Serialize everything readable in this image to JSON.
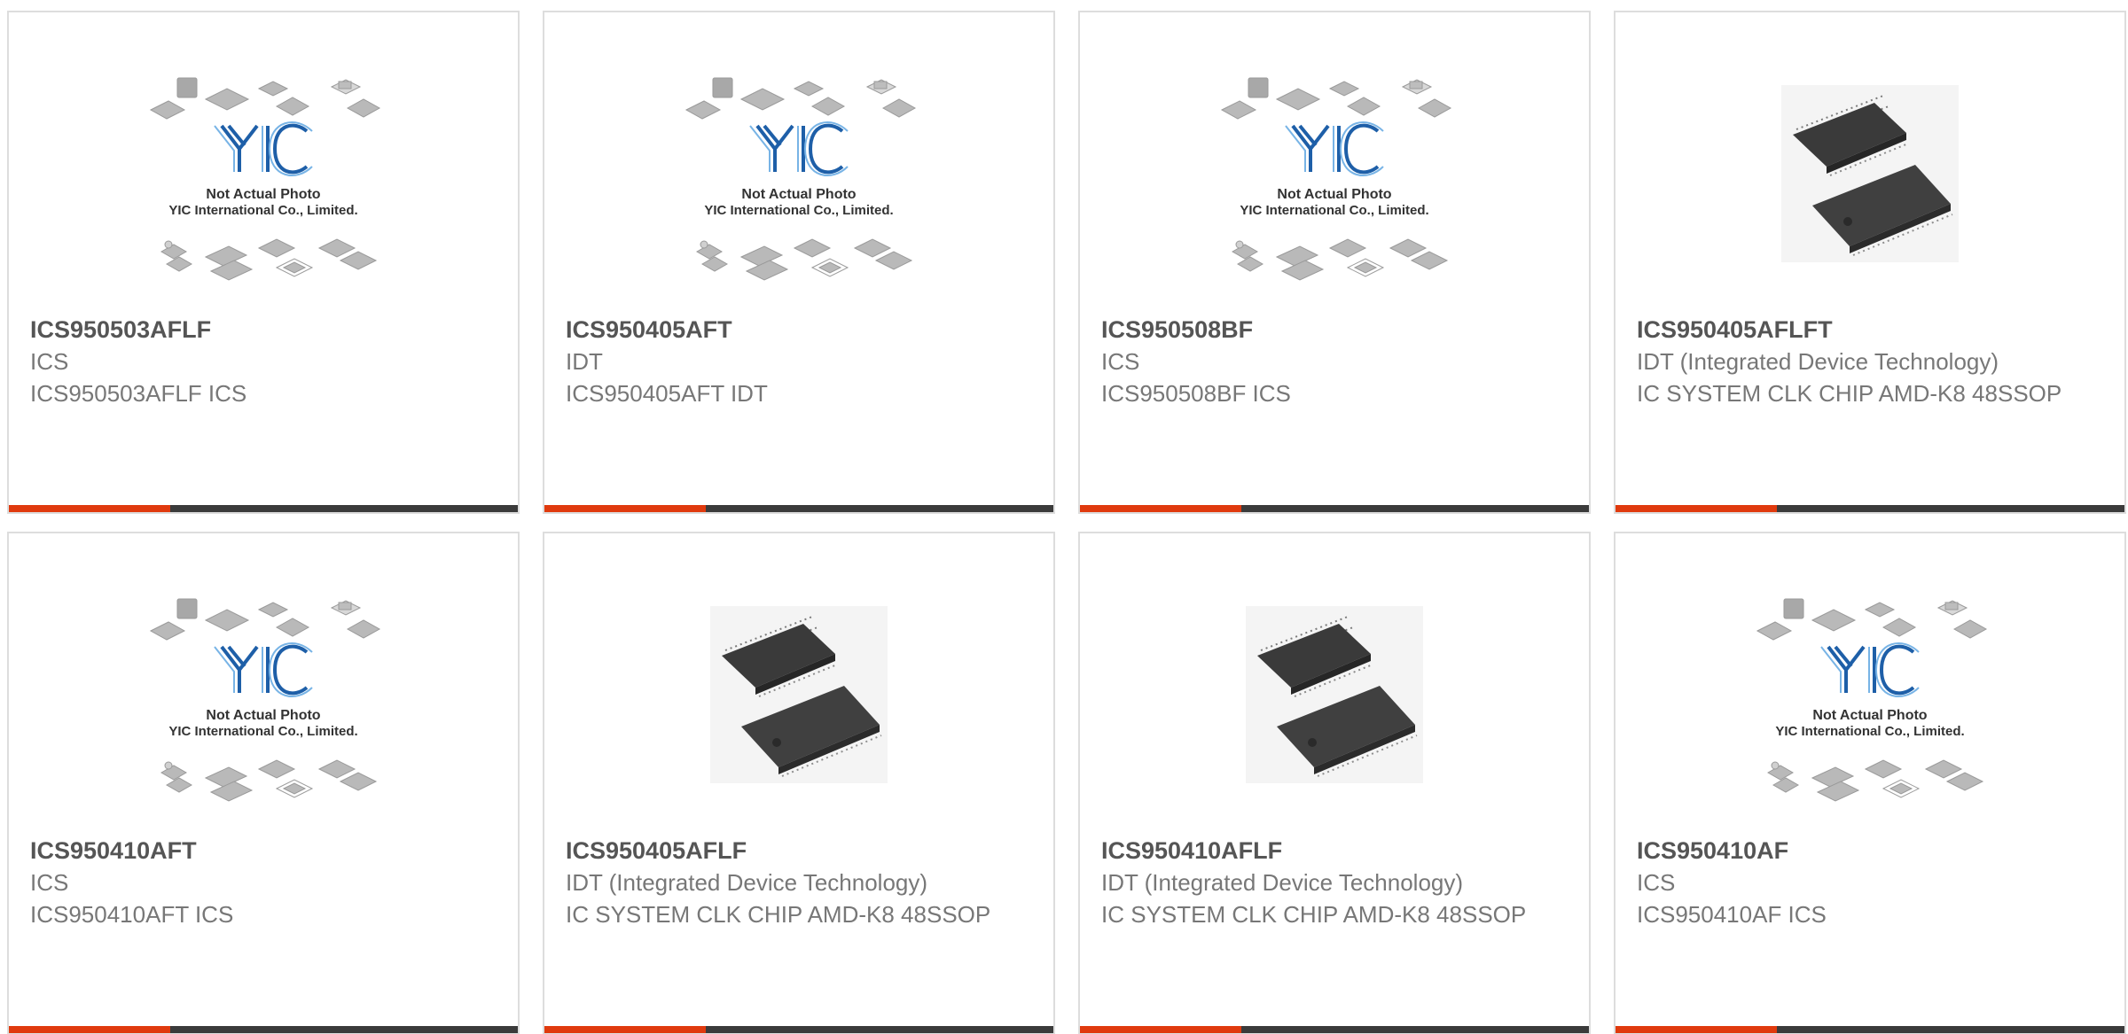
{
  "accent_color": "#e03a0e",
  "bar_color": "#3b3b3b",
  "placeholder": {
    "line1": "Not Actual Photo",
    "line2": "YIC International Co., Limited."
  },
  "products": [
    {
      "part_number": "ICS950503AFLF",
      "manufacturer": "ICS",
      "description": "ICS950503AFLF ICS",
      "image": "placeholder"
    },
    {
      "part_number": "ICS950405AFT",
      "manufacturer": "IDT",
      "description": "ICS950405AFT IDT",
      "image": "placeholder"
    },
    {
      "part_number": "ICS950508BF",
      "manufacturer": "ICS",
      "description": "ICS950508BF ICS",
      "image": "placeholder"
    },
    {
      "part_number": "ICS950405AFLFT",
      "manufacturer": "IDT (Integrated Device Technology)",
      "description": "IC SYSTEM CLK CHIP AMD-K8 48SSOP",
      "image": "ssop"
    },
    {
      "part_number": "ICS950410AFT",
      "manufacturer": "ICS",
      "description": "ICS950410AFT ICS",
      "image": "placeholder"
    },
    {
      "part_number": "ICS950405AFLF",
      "manufacturer": "IDT (Integrated Device Technology)",
      "description": "IC SYSTEM CLK CHIP AMD-K8 48SSOP",
      "image": "ssop"
    },
    {
      "part_number": "ICS950410AFLF",
      "manufacturer": "IDT (Integrated Device Technology)",
      "description": "IC SYSTEM CLK CHIP AMD-K8 48SSOP",
      "image": "ssop"
    },
    {
      "part_number": "ICS950410AF",
      "manufacturer": "ICS",
      "description": "ICS950410AF ICS",
      "image": "placeholder"
    }
  ]
}
